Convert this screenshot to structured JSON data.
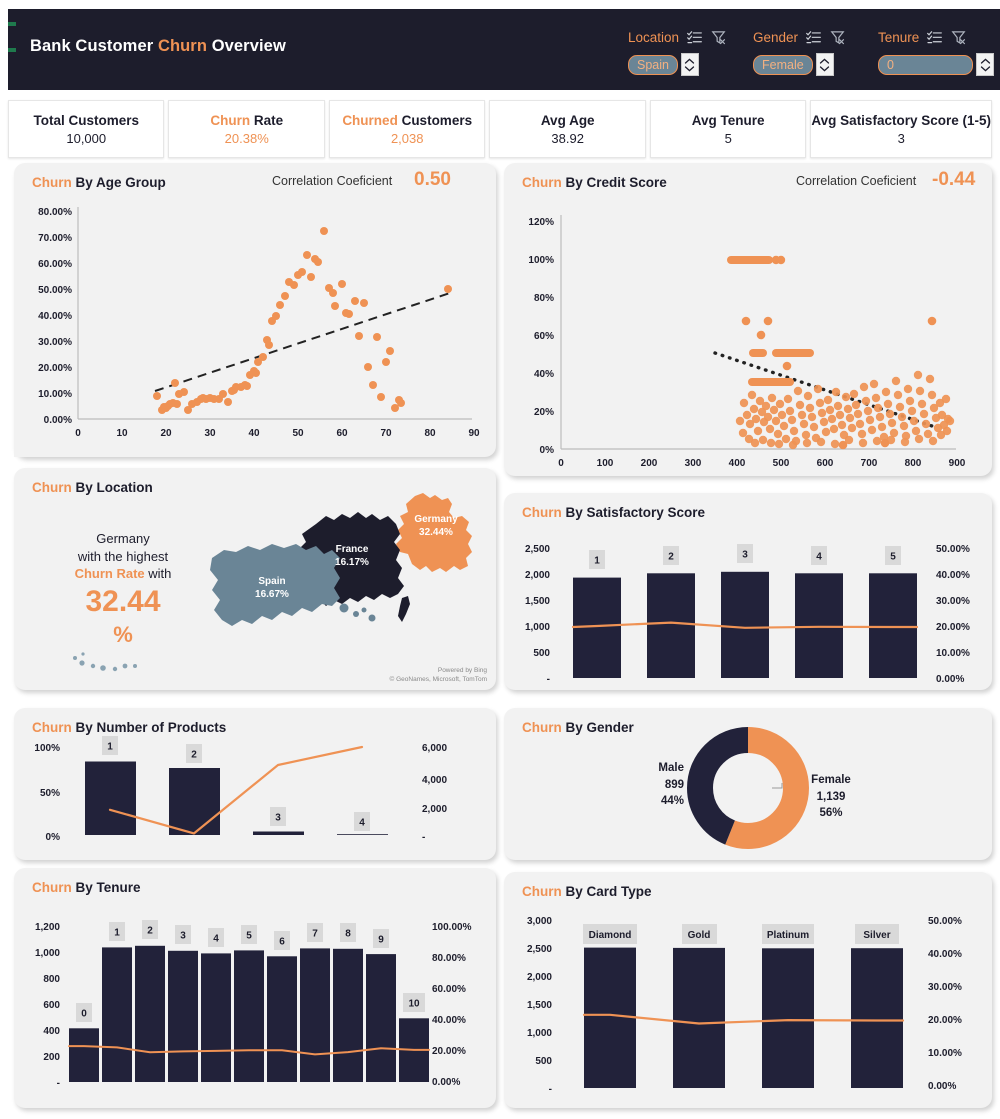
{
  "header": {
    "title_pre": "Bank Customer ",
    "title_hl": "Churn",
    "title_post": " Overview",
    "filters": [
      {
        "label": "Location",
        "value": "Spain",
        "list_icon": "multi-select-list-icon",
        "clear_icon": "clear-filter-icon"
      },
      {
        "label": "Gender",
        "value": "Female",
        "list_icon": "multi-select-list-icon",
        "clear_icon": "clear-filter-icon"
      },
      {
        "label": "Tenure",
        "value": "0",
        "list_icon": "multi-select-list-icon",
        "clear_icon": "clear-filter-icon"
      }
    ]
  },
  "kpis": [
    {
      "title_pre": "Total Customers",
      "title_hl": "",
      "title_post": "",
      "value": "10,000",
      "value_color": "dark"
    },
    {
      "title_pre": "",
      "title_hl": "Churn",
      "title_post": " Rate",
      "value": "20.38%",
      "value_color": "orange"
    },
    {
      "title_pre": "",
      "title_hl": "Churned",
      "title_post": " Customers",
      "value": "2,038",
      "value_color": "orange"
    },
    {
      "title_pre": "Avg Age",
      "title_hl": "",
      "title_post": "",
      "value": "38.92",
      "value_color": "dark"
    },
    {
      "title_pre": "Avg Tenure",
      "title_hl": "",
      "title_post": "",
      "value": "5",
      "value_color": "dark"
    },
    {
      "title_pre": "Avg Satisfactory Score (1-5)",
      "title_hl": "",
      "title_post": "",
      "value": "3",
      "value_color": "dark"
    }
  ],
  "panels": {
    "age": {
      "title_hl": "Churn",
      "title_post": " By Age Group",
      "corr_label": "Correlation Coeficient",
      "corr_value": "0.50"
    },
    "credit": {
      "title_hl": "Churn",
      "title_post": " By Credit Score",
      "corr_label": "Correlation Coeficient",
      "corr_value": "-0.44"
    },
    "location": {
      "title_hl": "Churn",
      "title_post": " By Location",
      "callout_l1": "Germany",
      "callout_l2": "with the highest",
      "callout_l3_hl": "Churn Rate",
      "callout_l3_post": " with",
      "callout_big": "32.44",
      "callout_pct": "%",
      "credit_l1": "Powered by Bing",
      "credit_l2": "© GeoNames, Microsoft, TomTom"
    },
    "satisfaction": {
      "title_hl": "Churn",
      "title_post": " By Satisfactory Score"
    },
    "products": {
      "title_hl": "Churn",
      "title_post": " By Number of Products"
    },
    "gender": {
      "title_hl": "Churn",
      "title_post": " By Gender"
    },
    "tenure": {
      "title_hl": "Churn",
      "title_post": " By Tenure"
    },
    "cardtype": {
      "title_hl": "Churn",
      "title_post": " By Card Type"
    }
  },
  "colors": {
    "accent_orange": "#ef9254",
    "dark_navy": "#1d1d2c",
    "panel_bg": "#f2f2f2",
    "steel_blue": "#6a8596",
    "green_stripe": "#1f7a4d"
  },
  "chart_data": [
    {
      "id": "churn-by-age-group",
      "type": "scatter",
      "title": "Churn By Age Group",
      "xlabel": "",
      "ylabel": "",
      "xlim": [
        0,
        90
      ],
      "ylim": [
        0,
        0.8
      ],
      "xticks": [
        0,
        10,
        20,
        30,
        40,
        50,
        60,
        70,
        80,
        90
      ],
      "yticks": [
        "0.00%",
        "10.00%",
        "20.00%",
        "30.00%",
        "40.00%",
        "50.00%",
        "60.00%",
        "70.00%",
        "80.00%"
      ],
      "annotation": {
        "label": "Correlation Coeficient",
        "value": 0.5
      },
      "trendline": {
        "style": "dashed",
        "color": "#222222",
        "x": [
          17.5,
          84.5
        ],
        "y": [
          0.105,
          0.475
        ]
      },
      "points": [
        [
          18,
          0.085
        ],
        [
          19,
          0.035
        ],
        [
          19.5,
          0.045
        ],
        [
          20,
          0.04
        ],
        [
          20.5,
          0.05
        ],
        [
          21,
          0.055
        ],
        [
          21.5,
          0.06
        ],
        [
          22,
          0.135
        ],
        [
          22.5,
          0.055
        ],
        [
          23,
          0.095
        ],
        [
          24,
          0.1
        ],
        [
          25,
          0.035
        ],
        [
          26,
          0.055
        ],
        [
          27,
          0.065
        ],
        [
          28,
          0.075
        ],
        [
          28.5,
          0.08
        ],
        [
          29,
          0.075
        ],
        [
          30,
          0.08
        ],
        [
          31,
          0.075
        ],
        [
          32,
          0.075
        ],
        [
          33,
          0.095
        ],
        [
          34,
          0.065
        ],
        [
          35,
          0.105
        ],
        [
          35.5,
          0.11
        ],
        [
          36,
          0.12
        ],
        [
          37,
          0.12
        ],
        [
          38,
          0.13
        ],
        [
          38.5,
          0.125
        ],
        [
          39,
          0.165
        ],
        [
          40,
          0.18
        ],
        [
          40.5,
          0.175
        ],
        [
          41,
          0.215
        ],
        [
          42,
          0.235
        ],
        [
          43,
          0.3
        ],
        [
          43.5,
          0.28
        ],
        [
          44,
          0.37
        ],
        [
          45,
          0.39
        ],
        [
          46,
          0.43
        ],
        [
          47,
          0.465
        ],
        [
          48,
          0.515
        ],
        [
          49,
          0.505
        ],
        [
          50,
          0.545
        ],
        [
          51,
          0.555
        ],
        [
          52,
          0.62
        ],
        [
          53,
          0.535
        ],
        [
          54,
          0.605
        ],
        [
          54.5,
          0.595
        ],
        [
          56,
          0.71
        ],
        [
          57,
          0.495
        ],
        [
          58,
          0.475
        ],
        [
          58.5,
          0.425
        ],
        [
          60,
          0.51
        ],
        [
          61,
          0.4
        ],
        [
          61.5,
          0.395
        ],
        [
          63,
          0.445
        ],
        [
          64,
          0.315
        ],
        [
          65,
          0.44
        ],
        [
          66,
          0.195
        ],
        [
          67,
          0.13
        ],
        [
          68,
          0.31
        ],
        [
          69,
          0.085
        ],
        [
          70,
          0.215
        ],
        [
          71,
          0.255
        ],
        [
          72,
          0.045
        ],
        [
          73,
          0.075
        ],
        [
          73.5,
          0.06
        ],
        [
          84,
          0.49
        ]
      ]
    },
    {
      "id": "churn-by-credit-score",
      "type": "scatter",
      "title": "Churn By Credit Score",
      "xlim": [
        0,
        900
      ],
      "ylim": [
        0,
        1.2
      ],
      "xticks": [
        0,
        100,
        200,
        300,
        400,
        500,
        600,
        700,
        800,
        900
      ],
      "yticks": [
        "0%",
        "20%",
        "40%",
        "60%",
        "80%",
        "100%",
        "120%"
      ],
      "annotation": {
        "label": "Correlation Coeficient",
        "value": -0.44
      },
      "trendline": {
        "style": "dotted",
        "color": "#222222",
        "x": [
          350,
          850
        ],
        "y": [
          0.495,
          0.115
        ]
      },
      "clusters": [
        {
          "note": "100% band",
          "x_range": [
            378,
            432
          ],
          "y": 1.0,
          "count": 26
        },
        {
          "note": "48% band",
          "x_range": [
            408,
            425
          ],
          "y": 0.485,
          "count": 8
        },
        {
          "note": "48% band b",
          "x_range": [
            437,
            478
          ],
          "y": 0.485,
          "count": 16
        },
        {
          "note": "33% band",
          "x_range": [
            408,
            452
          ],
          "y": 0.335,
          "count": 18
        },
        {
          "note": "main cloud",
          "x_range": [
            410,
            860
          ],
          "y_range": [
            0.02,
            0.45
          ],
          "count": 430
        },
        {
          "note": "outliers",
          "points": [
            [
              420,
              0.66
            ],
            [
              470,
              0.665
            ],
            [
              455,
              0.595
            ],
            [
              845,
              0.66
            ],
            [
              510,
              0.45
            ],
            [
              640,
              0.02
            ],
            [
              735,
              0.03
            ]
          ]
        }
      ]
    },
    {
      "id": "churn-by-location",
      "type": "map",
      "title": "Churn By Location",
      "regions": [
        {
          "name": "Germany",
          "value": "32.44%",
          "numeric": 32.44,
          "color": "#ef9254"
        },
        {
          "name": "France",
          "value": "16.17%",
          "numeric": 16.17,
          "color": "#1d1d2c"
        },
        {
          "name": "Spain",
          "value": "16.67%",
          "numeric": 16.67,
          "color": "#6a8596"
        }
      ],
      "highest": {
        "region": "Germany",
        "rate": 32.44
      }
    },
    {
      "id": "churn-by-satisfactory-score",
      "type": "bar",
      "title": "Churn By Satisfactory Score",
      "categories": [
        "1",
        "2",
        "3",
        "4",
        "5"
      ],
      "series": [
        {
          "name": "Customers",
          "type": "bar",
          "values": [
            1932,
            2014,
            2042,
            2014,
            2014
          ],
          "axis": "left",
          "color": "#22223a"
        },
        {
          "name": "Churn Rate",
          "type": "line",
          "values": [
            0.196,
            0.213,
            0.193,
            0.197,
            0.196
          ],
          "axis": "right",
          "color": "#ef9254"
        }
      ],
      "left_ticks": [
        "-",
        "500",
        "1,000",
        "1,500",
        "2,000",
        "2,500"
      ],
      "right_ticks": [
        "0.00%",
        "10.00%",
        "20.00%",
        "30.00%",
        "40.00%",
        "50.00%"
      ],
      "ylim_left": [
        0,
        2500
      ],
      "ylim_right": [
        0,
        0.5
      ]
    },
    {
      "id": "churn-by-number-of-products",
      "type": "bar",
      "title": "Churn By Number of Products",
      "categories": [
        "1",
        "2",
        "3",
        "4"
      ],
      "series": [
        {
          "name": "Churn Rate",
          "type": "bar",
          "values": [
            0.277,
            0.076,
            0.827,
            1.0
          ],
          "axis": "left",
          "color": "#22223a",
          "note": "bars render as counts"
        },
        {
          "name": "Customers",
          "type": "line",
          "values": [
            5084,
            4590,
            266,
            60
          ],
          "axis": "right",
          "color": "#ef9254"
        }
      ],
      "bar_values_count": [
        5084,
        4590,
        266,
        60
      ],
      "left_ticks": [
        "0%",
        "50%",
        "100%"
      ],
      "right_ticks": [
        "-",
        "2,000",
        "4,000",
        "6,000"
      ],
      "ylim_left": [
        0,
        1.0
      ],
      "ylim_right": [
        0,
        6000
      ]
    },
    {
      "id": "churn-by-gender",
      "type": "pie",
      "title": "Churn By Gender",
      "labels": [
        "Female",
        "Male"
      ],
      "values": [
        1139,
        899
      ],
      "percents": [
        "56%",
        "44%"
      ],
      "colors": [
        "#ef9254",
        "#22223a"
      ],
      "donut": true
    },
    {
      "id": "churn-by-tenure",
      "type": "bar",
      "title": "Churn By Tenure",
      "categories": [
        "0",
        "1",
        "2",
        "3",
        "4",
        "5",
        "6",
        "7",
        "8",
        "9",
        "10"
      ],
      "series": [
        {
          "name": "Customers",
          "type": "bar",
          "values": [
            413,
            1035,
            1048,
            1009,
            989,
            1012,
            967,
            1028,
            1025,
            984,
            490
          ],
          "axis": "left",
          "color": "#22223a"
        },
        {
          "name": "Churn Rate",
          "type": "line",
          "values": [
            0.23,
            0.222,
            0.191,
            0.196,
            0.199,
            0.203,
            0.203,
            0.177,
            0.192,
            0.216,
            0.206
          ],
          "axis": "right",
          "color": "#ef9254"
        }
      ],
      "left_ticks": [
        "-",
        "200",
        "400",
        "600",
        "800",
        "1,000",
        "1,200"
      ],
      "right_ticks": [
        "0.00%",
        "20.00%",
        "40.00%",
        "60.00%",
        "80.00%",
        "100.00%"
      ],
      "ylim_left": [
        0,
        1200
      ],
      "ylim_right": [
        0,
        1.0
      ]
    },
    {
      "id": "churn-by-card-type",
      "type": "bar",
      "title": "Churn By Card Type",
      "categories": [
        "Diamond",
        "Gold",
        "Platinum",
        "Silver"
      ],
      "series": [
        {
          "name": "Customers",
          "type": "bar",
          "values": [
            2507,
            2502,
            2495,
            2496
          ],
          "axis": "left",
          "color": "#22223a"
        },
        {
          "name": "Churn Rate",
          "type": "line",
          "values": [
            0.218,
            0.192,
            0.202,
            0.201
          ],
          "axis": "right",
          "color": "#ef9254"
        }
      ],
      "left_ticks": [
        "-",
        "500",
        "1,000",
        "1,500",
        "2,000",
        "2,500",
        "3,000"
      ],
      "right_ticks": [
        "0.00%",
        "10.00%",
        "20.00%",
        "30.00%",
        "40.00%",
        "50.00%"
      ],
      "ylim_left": [
        0,
        3000
      ],
      "ylim_right": [
        0,
        0.5
      ]
    }
  ]
}
